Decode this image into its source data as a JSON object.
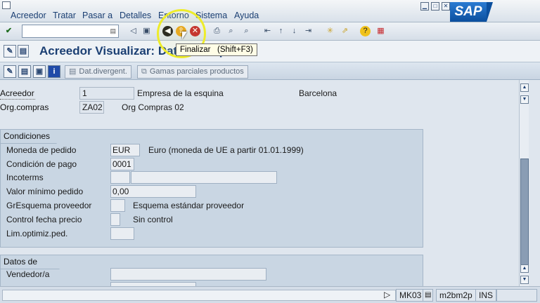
{
  "menu": [
    "Acreedor",
    "Tratar",
    "Pasar a",
    "Detalles",
    "Entorno",
    "Sistema",
    "Ayuda"
  ],
  "logo": "SAP",
  "title": "Acreedor Visualizar: Datos compras",
  "tooltip": "Finalizar   (Shift+F3)",
  "app_buttons": {
    "divergent": "Dat.divergent.",
    "ranges": "Gamas parciales productos"
  },
  "header": {
    "vendor_label": "Acreedor",
    "vendor_value": "1",
    "vendor_name": "Empresa de la esquina",
    "vendor_city": "Barcelona",
    "org_label": "Org.compras",
    "org_value": "ZA02",
    "org_name": "Org Compras 02"
  },
  "conditions": {
    "title": "Condiciones",
    "fields": [
      {
        "label": "Moneda de pedido",
        "value": "EUR",
        "text": "Euro (moneda de UE a partir 01.01.1999)"
      },
      {
        "label": "Condición de pago",
        "value": "0001",
        "text": ""
      },
      {
        "label": "Incoterms",
        "value": "",
        "text": ""
      },
      {
        "label": "Valor mínimo pedido",
        "value": "0,00",
        "text": ""
      },
      {
        "label": "GrEsquema proveedor",
        "value": "",
        "text": "Esquema estándar proveedor"
      },
      {
        "label": "Control fecha precio",
        "value": "",
        "text": "Sin control"
      },
      {
        "label": "Lim.optimiz.ped.",
        "value": "",
        "text": ""
      }
    ]
  },
  "sales": {
    "title": "Datos de venta",
    "fields": [
      {
        "label": "Vendedor/a",
        "value": ""
      }
    ]
  },
  "status": {
    "transaction": "MK03",
    "server": "m2bm2p",
    "mode": "INS"
  },
  "icons": {
    "enter": "check-icon",
    "back": "back-icon",
    "exit": "exit-icon",
    "cancel": "cancel-icon"
  }
}
